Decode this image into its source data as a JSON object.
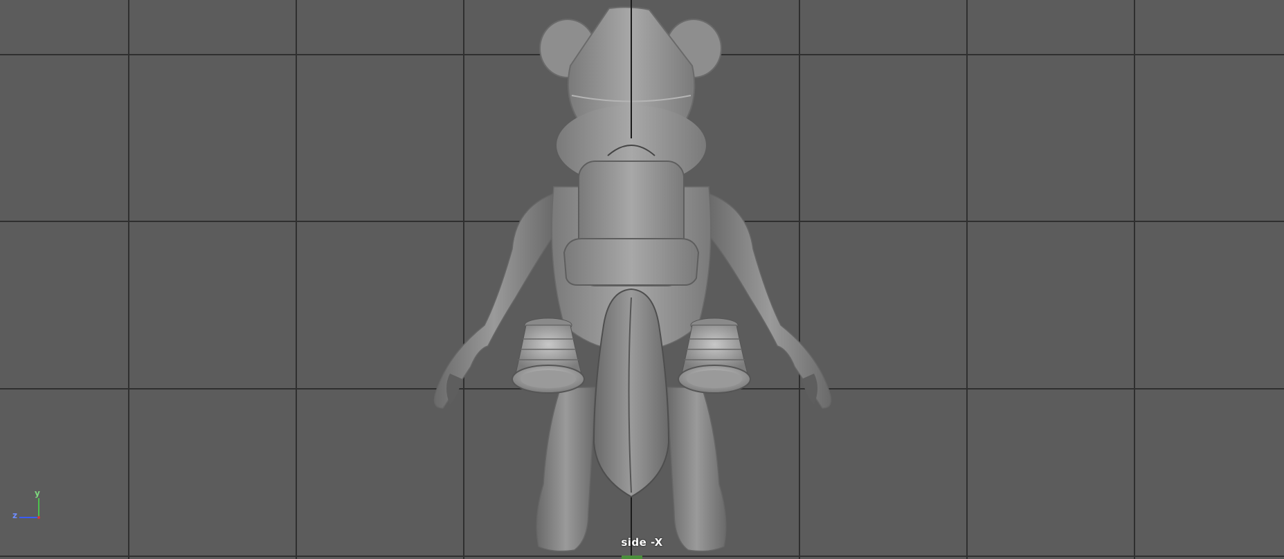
{
  "viewport": {
    "camera_label": "side -X",
    "background_color": "#5c5c5c",
    "grid_color": "#2f2f2f",
    "model_color": "#9a9a9a"
  },
  "axis_gizmo": {
    "y_label": "y",
    "z_label": "z",
    "y_color": "#4cc24c",
    "z_color": "#3a5cff",
    "x_color": "#d23a3a"
  }
}
